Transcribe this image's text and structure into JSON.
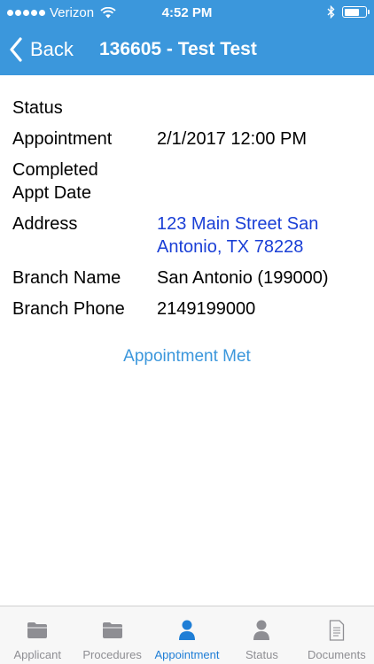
{
  "status_bar": {
    "carrier": "Verizon",
    "time": "4:52 PM",
    "battery_level": 0.7
  },
  "nav": {
    "back_label": "Back",
    "title": "136605 - Test Test"
  },
  "details": {
    "status": {
      "label": "Status",
      "value": ""
    },
    "appointment": {
      "label": "Appointment",
      "value": "2/1/2017 12:00 PM"
    },
    "completed": {
      "label": "Completed Appt Date",
      "value": ""
    },
    "address": {
      "label": "Address",
      "value": "123 Main Street San Antonio, TX 78228"
    },
    "branch_name": {
      "label": "Branch Name",
      "value": "San Antonio (199000)"
    },
    "branch_phone": {
      "label": "Branch Phone",
      "value": "2149199000"
    }
  },
  "action": {
    "label": "Appointment Met"
  },
  "tabs": [
    {
      "label": "Applicant",
      "icon": "folder-icon",
      "active": false
    },
    {
      "label": "Procedures",
      "icon": "folder-icon",
      "active": false
    },
    {
      "label": "Appointment",
      "icon": "person-icon",
      "active": true
    },
    {
      "label": "Status",
      "icon": "person-icon",
      "active": false
    },
    {
      "label": "Documents",
      "icon": "document-icon",
      "active": false
    }
  ],
  "colors": {
    "header": "#3b97dc",
    "link": "#1a3fd6",
    "active_tab": "#1f7ed6",
    "inactive_tab": "#8e8e93"
  }
}
